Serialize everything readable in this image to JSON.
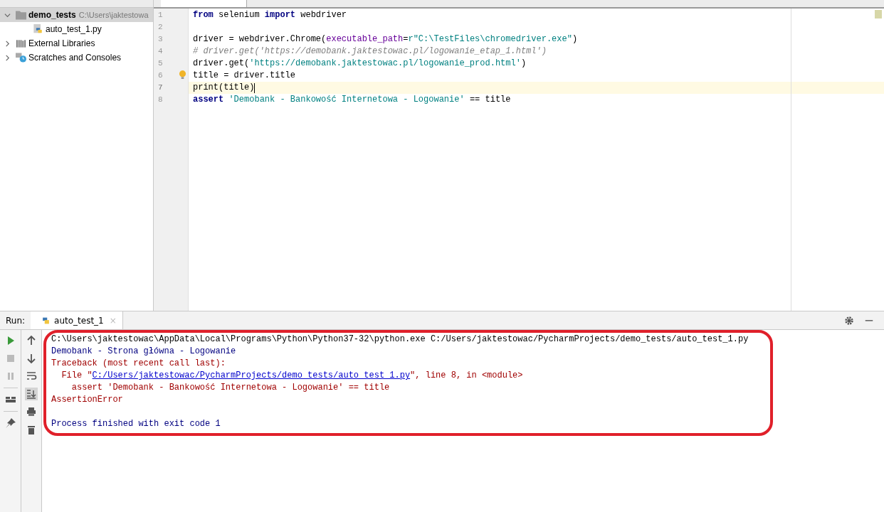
{
  "project_tree": [
    {
      "label": "demo_tests",
      "path": "C:\\Users\\jaktestowa",
      "kind": "folder",
      "expanded": true,
      "selected": true,
      "children": [
        {
          "label": "auto_test_1.py",
          "kind": "python",
          "selected": false
        }
      ]
    },
    {
      "label": "External Libraries",
      "kind": "libraries",
      "expanded": false,
      "selected": false
    },
    {
      "label": "Scratches and Consoles",
      "kind": "scratches",
      "expanded": false,
      "selected": false
    }
  ],
  "editor": {
    "lines": [
      {
        "number": "1",
        "current": false,
        "segments": [
          {
            "kind": "keyword",
            "text": "from"
          },
          {
            "kind": "plain",
            "text": " selenium "
          },
          {
            "kind": "keyword",
            "text": "import"
          },
          {
            "kind": "plain",
            "text": " webdriver"
          }
        ]
      },
      {
        "number": "2",
        "current": false
      },
      {
        "number": "3",
        "current": false,
        "segments": [
          {
            "kind": "plain",
            "text": "driver = webdriver.Chrome("
          },
          {
            "kind": "param",
            "text": "executable_path"
          },
          {
            "kind": "plain",
            "text": "="
          },
          {
            "kind": "string",
            "text": "r\"C:\\TestFiles\\chromedriver.exe\""
          },
          {
            "kind": "plain",
            "text": ")"
          }
        ]
      },
      {
        "number": "4",
        "current": false,
        "segments": [
          {
            "kind": "comment",
            "text": "# driver.get('https://demobank.jaktestowac.pl/logowanie_etap_1.html')"
          }
        ]
      },
      {
        "number": "5",
        "current": false,
        "segments": [
          {
            "kind": "plain",
            "text": "driver.get("
          },
          {
            "kind": "string",
            "text": "'https://demobank.jaktestowac.pl/logowanie_prod.html'"
          },
          {
            "kind": "plain",
            "text": ")"
          }
        ]
      },
      {
        "number": "6",
        "current": false,
        "segments": [
          {
            "kind": "plain",
            "text": "title = driver.title"
          }
        ]
      },
      {
        "number": "7",
        "current": true,
        "segments": [
          {
            "kind": "plain",
            "text": "print(title)"
          }
        ]
      },
      {
        "number": "8",
        "current": false,
        "segments": [
          {
            "kind": "keyword",
            "text": "assert "
          },
          {
            "kind": "string",
            "text": "'Demobank - Bankowość Internetowa - Logowanie'"
          },
          {
            "kind": "plain",
            "text": " == title"
          }
        ]
      }
    ]
  },
  "run_panel": {
    "label": "Run:",
    "tabs": [
      {
        "label": "auto_test_1",
        "close": "×",
        "selected": true
      }
    ],
    "console": [
      {
        "segments": [
          {
            "kind": "command",
            "text": "C:\\Users\\jaktestowac\\AppData\\Local\\Programs\\Python\\Python37-32\\python.exe C:/Users/jaktestowac/PycharmProjects/demo_tests/auto_test_1.py"
          }
        ]
      },
      {
        "segments": [
          {
            "kind": "output",
            "text": "Demobank - Strona główna - Logowanie"
          }
        ]
      },
      {
        "segments": [
          {
            "kind": "error",
            "text": "Traceback (most recent call last):"
          }
        ]
      },
      {
        "segments": [
          {
            "kind": "error",
            "text": "  File \""
          },
          {
            "kind": "link",
            "text": "C:/Users/jaktestowac/PycharmProjects/demo_tests/auto_test_1.py"
          },
          {
            "kind": "error",
            "text": "\", line 8, in <module>"
          }
        ]
      },
      {
        "segments": [
          {
            "kind": "error",
            "text": "    assert 'Demobank - Bankowość Internetowa - Logowanie' == title"
          }
        ]
      },
      {
        "segments": [
          {
            "kind": "error",
            "text": "AssertionError"
          }
        ]
      },
      {
        "spaced": true,
        "segments": [
          {
            "kind": "output",
            "text": "Process finished with exit code 1"
          }
        ]
      }
    ]
  }
}
